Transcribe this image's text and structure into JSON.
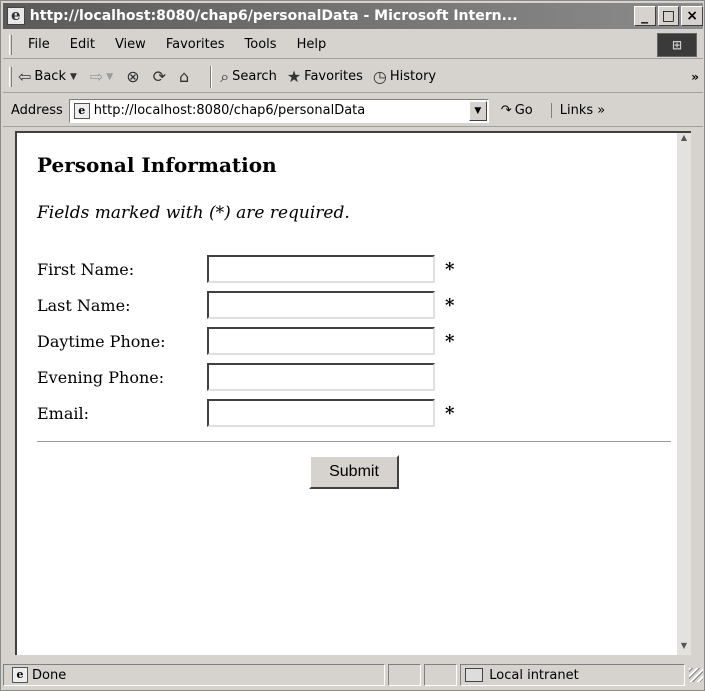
{
  "window": {
    "title": "http://localhost:8080/chap6/personalData - Microsoft Intern...",
    "minimize": "_",
    "maximize": "□",
    "close": "×"
  },
  "menu": {
    "items": [
      "File",
      "Edit",
      "View",
      "Favorites",
      "Tools",
      "Help"
    ]
  },
  "toolbar": {
    "back": "Back",
    "forward": "",
    "search": "Search",
    "favorites": "Favorites",
    "history": "History",
    "more": "»"
  },
  "address": {
    "label": "Address",
    "url": "http://localhost:8080/chap6/personalData",
    "go": "Go",
    "links": "Links »"
  },
  "page": {
    "heading": "Personal Information",
    "note": "Fields marked with (*) are required.",
    "fields": [
      {
        "label": "First Name:",
        "value": "",
        "required": "*"
      },
      {
        "label": "Last Name:",
        "value": "",
        "required": "*"
      },
      {
        "label": "Daytime Phone:",
        "value": "",
        "required": "*"
      },
      {
        "label": "Evening Phone:",
        "value": "",
        "required": ""
      },
      {
        "label": "Email:",
        "value": "",
        "required": "*"
      }
    ],
    "submit": "Submit"
  },
  "status": {
    "text": "Done",
    "zone": "Local intranet"
  }
}
